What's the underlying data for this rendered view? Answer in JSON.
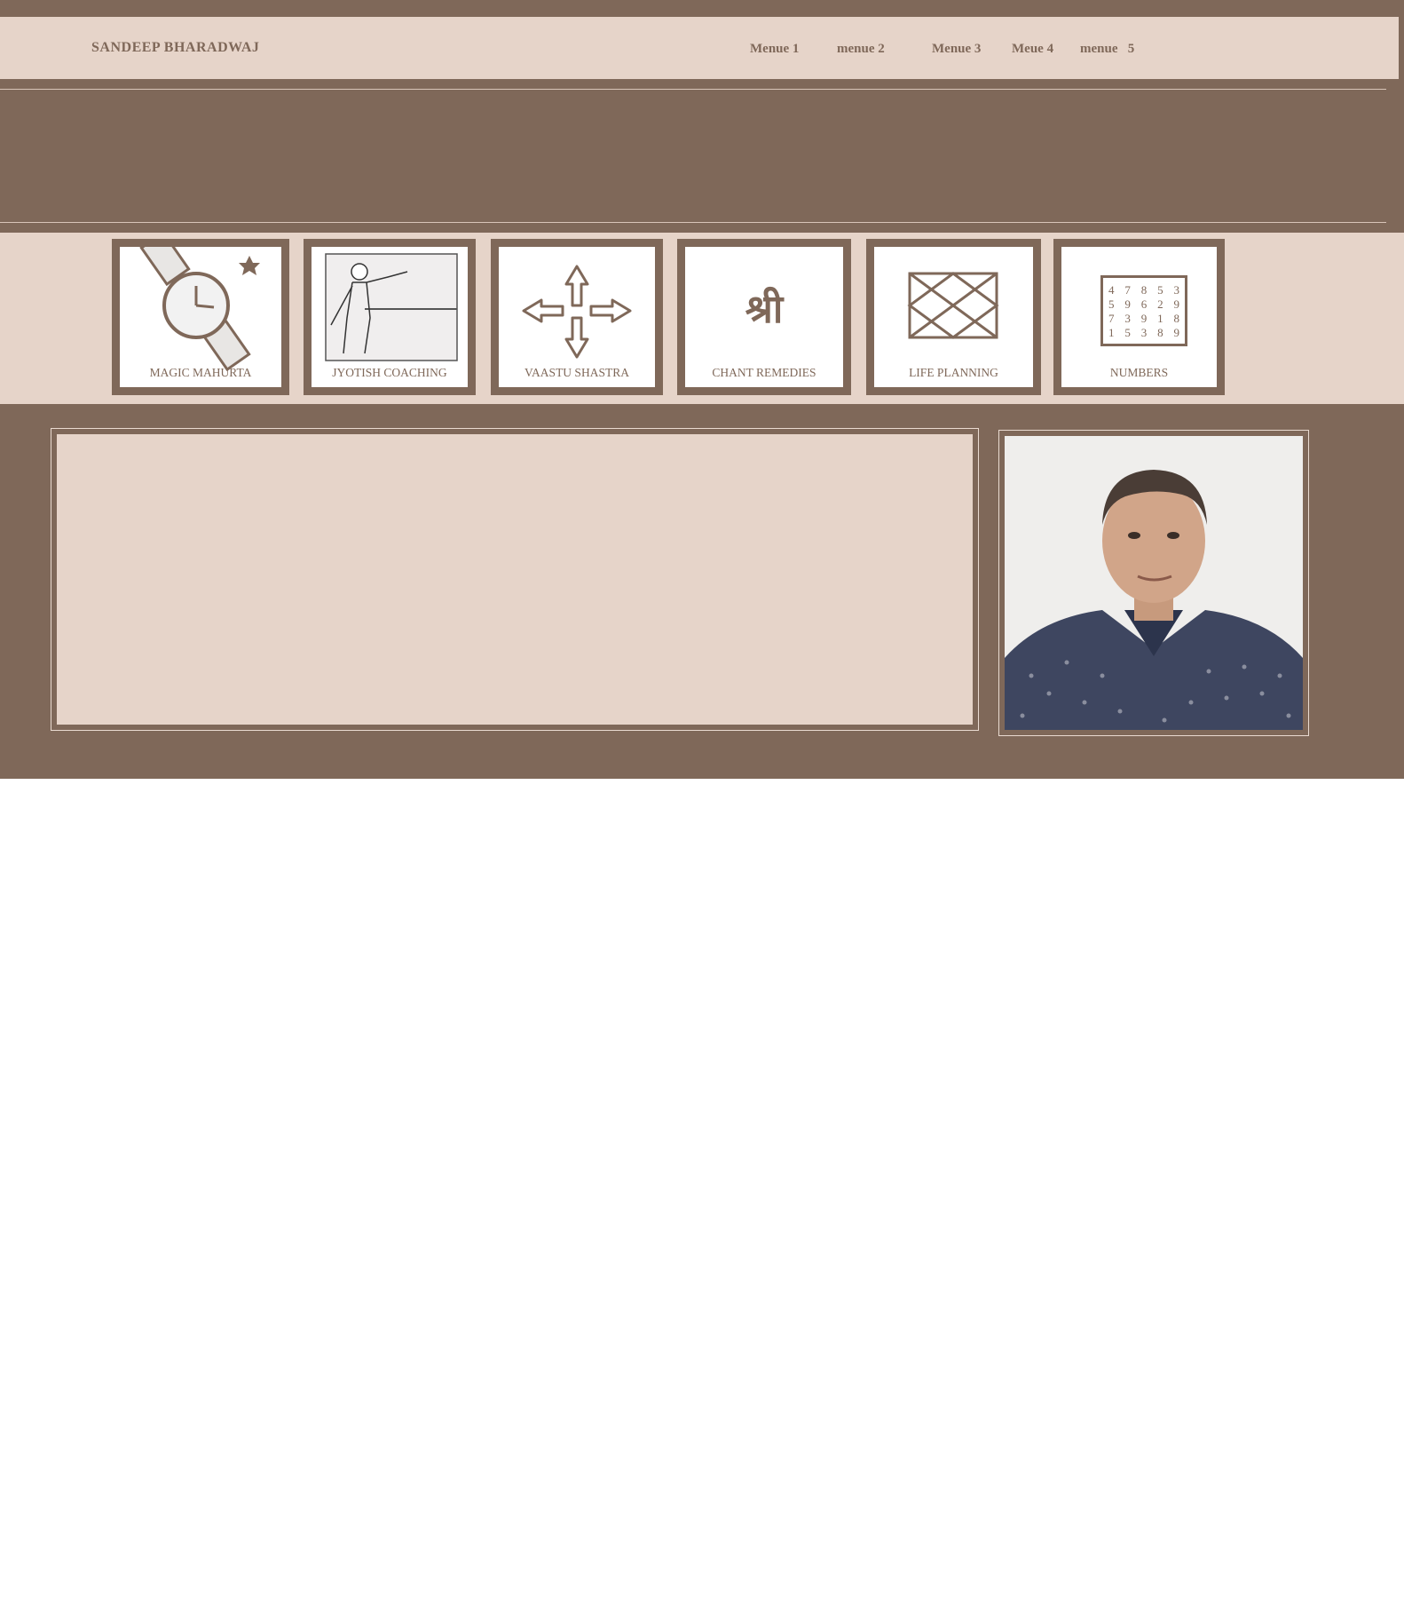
{
  "header": {
    "brand": "SANDEEP BHARADWAJ",
    "menu": [
      {
        "label": "Menue 1"
      },
      {
        "label": "menue 2"
      },
      {
        "label": "Menue 3"
      },
      {
        "label": "Meue 4"
      },
      {
        "label": "menue   5"
      }
    ]
  },
  "tiles": [
    {
      "label": "MAGIC MAHURTA",
      "icon": "watch-icon"
    },
    {
      "label": "JYOTISH COACHING",
      "icon": "teacher-board-icon"
    },
    {
      "label": "VAASTU SHASTRA",
      "icon": "four-arrows-icon"
    },
    {
      "label": "CHANT REMEDIES",
      "icon": "shri-glyph-icon"
    },
    {
      "label": "LIFE PLANNING",
      "icon": "birth-chart-icon"
    },
    {
      "label": "NUMBERS",
      "icon": "number-grid-icon"
    }
  ],
  "shri_glyph": "श्री",
  "number_grid": [
    [
      "4",
      "7",
      "8",
      "5",
      "3"
    ],
    [
      "5",
      "9",
      "6",
      "2",
      "9"
    ],
    [
      "7",
      "3",
      "9",
      "1",
      "8"
    ],
    [
      "1",
      "5",
      "3",
      "8",
      "9"
    ]
  ],
  "colors": {
    "brown": "#7f6859",
    "beige": "#e6d4c9",
    "white": "#ffffff"
  }
}
